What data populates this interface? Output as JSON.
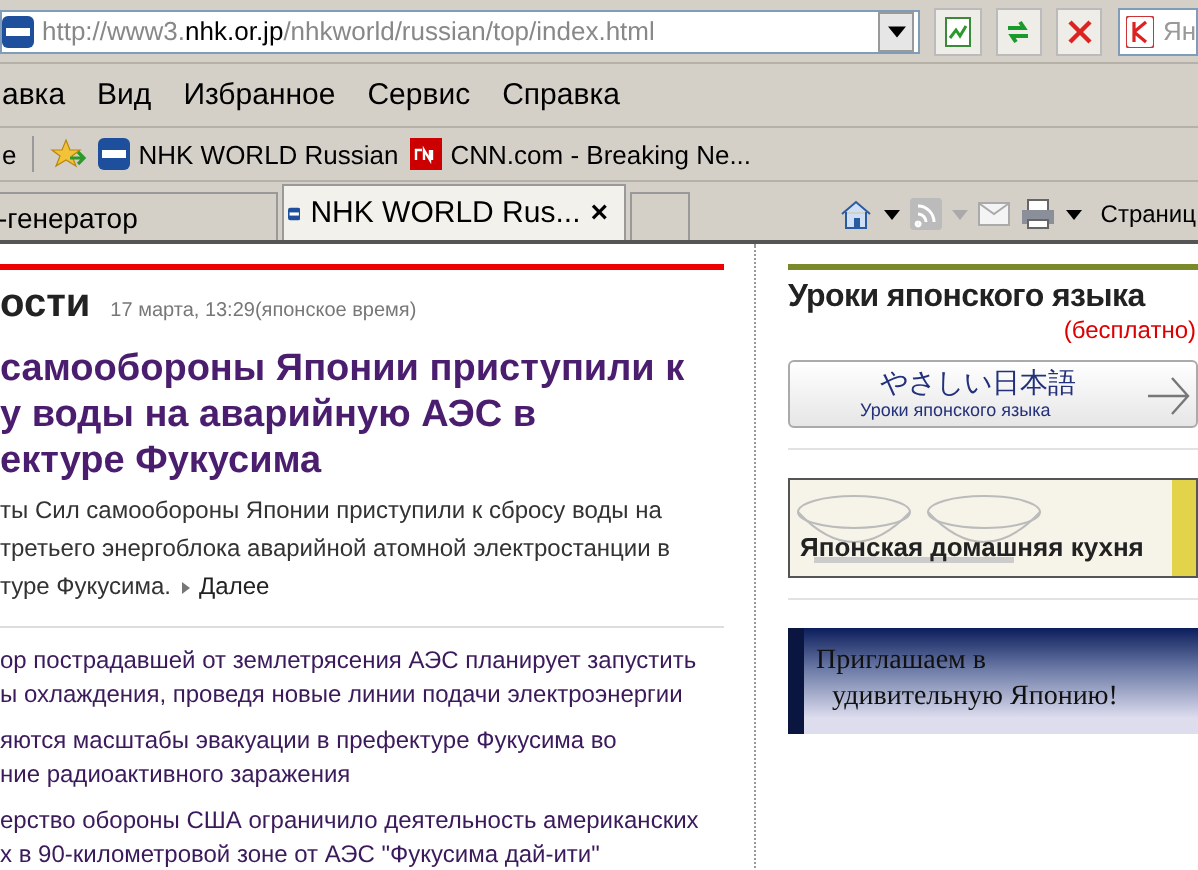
{
  "address_bar": {
    "url_prefix": "http://www3.",
    "url_domain": "nhk.or.jp",
    "url_path": "/nhkworld/russian/top/index.html",
    "search_text": "Ян"
  },
  "menu": [
    "авка",
    "Вид",
    "Избранное",
    "Сервис",
    "Справка"
  ],
  "favorites_bar": {
    "cut_item": "е",
    "items": [
      {
        "label": "NHK WORLD Russian",
        "kind": "nhk"
      },
      {
        "label": "CNN.com - Breaking Ne...",
        "kind": "cnn"
      }
    ]
  },
  "tabs": [
    {
      "label": "-генератор",
      "selected": false
    },
    {
      "label": "NHK WORLD Rus...",
      "selected": true,
      "close": "×"
    }
  ],
  "command_bar": {
    "page_menu": "Страниц"
  },
  "news": {
    "section_title": "ости",
    "timestamp": "17 марта, 13:29(японское время)",
    "headline_lines": [
      "самообороны Японии приступили к",
      "у воды на аварийную АЭС в",
      "ектуре Фукусима"
    ],
    "summary_lines": [
      "ты Сил самообороны Японии приступили к сбросу воды на",
      "третьего энергоблока аварийной атомной электростанции в",
      "туре Фукусима."
    ],
    "more_link": "Далее",
    "related": [
      {
        "lines": [
          "ор пострадавшей от землетрясения АЭС планирует запустить",
          "ы охлаждения, проведя новые линии подачи электроэнергии"
        ]
      },
      {
        "lines": [
          "яются масштабы эвакуации в префектуре Фукусима во",
          "ние радиоактивного заражения"
        ]
      },
      {
        "lines": [
          "ерство обороны США ограничило деятельность американских",
          "х в 90-километровой зоне от АЭС \"Фукусима дай-ити\""
        ]
      }
    ]
  },
  "sidebar": {
    "title": "Уроки японского языка",
    "subtitle": "(бесплатно)",
    "lesson_button": {
      "japanese": "やさしい日本語",
      "russian": "Уроки японского языка"
    },
    "cooking_banner": "Японская домашняя кухня",
    "travel_banner_lines": [
      "Приглашаем в",
      "удивительную Японию!"
    ]
  }
}
